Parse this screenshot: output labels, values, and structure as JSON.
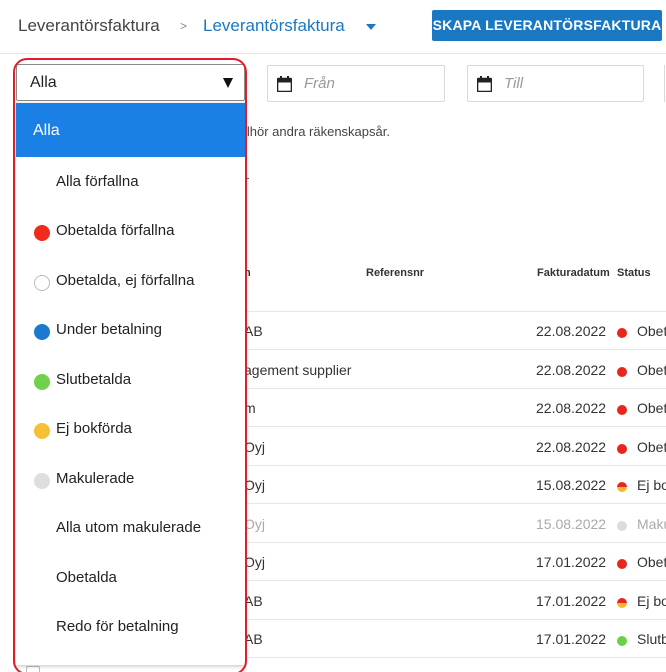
{
  "header": {
    "breadcrumb_root": "Leverantörsfaktura",
    "breadcrumb_sep": ">",
    "breadcrumb_current": "Leverantörsfaktura",
    "create_button": "SKAPA LEVERANTÖRSFAKTURA"
  },
  "filters": {
    "select_value": "Alla",
    "from_placeholder": "Från",
    "to_placeholder": "Till"
  },
  "hint_text": "llhör andra räkenskapsår.",
  "table": {
    "columns": {
      "name": "n",
      "ref": "Referensnr",
      "date": "Fakturadatum",
      "status": "Status"
    },
    "rows": [
      {
        "name": "AB",
        "date": "22.08.2022",
        "status": "Obet",
        "color": "#e8261d"
      },
      {
        "name": "agement supplier",
        "date": "22.08.2022",
        "status": "Obet",
        "color": "#e8261d"
      },
      {
        "name": "m",
        "date": "22.08.2022",
        "status": "Obet",
        "color": "#e8261d"
      },
      {
        "name": "Oyj",
        "date": "22.08.2022",
        "status": "Obet",
        "color": "#e8261d"
      },
      {
        "name": "Oyj",
        "date": "15.08.2022",
        "status": "Ej bok",
        "color": "#e8261d",
        "color2": "#f5b82e"
      },
      {
        "name": "Oyj",
        "date": "15.08.2022",
        "status": "Maku",
        "color": "#dcdcdc",
        "muted": true
      },
      {
        "name": "Oyj",
        "date": "17.01.2022",
        "status": "Obet",
        "color": "#e8261d"
      },
      {
        "name": "AB",
        "date": "17.01.2022",
        "status": "Ej bo",
        "color": "#e8261d",
        "color2": "#f5b82e"
      },
      {
        "name": "AB",
        "date": "17.01.2022",
        "status": "Slutb",
        "color": "#6ccf4a"
      }
    ]
  },
  "dropdown": {
    "options": [
      {
        "label": "Alla",
        "dot": null,
        "selected": true
      },
      {
        "label": "Alla förfallna",
        "dot": null
      },
      {
        "label": "Obetalda förfallna",
        "dot": "#f02a1c"
      },
      {
        "label": "Obetalda, ej förfallna",
        "dot": "outline"
      },
      {
        "label": "Under betalning",
        "dot": "#1a7ad0"
      },
      {
        "label": "Slutbetalda",
        "dot": "#72d14c"
      },
      {
        "label": "Ej bokförda",
        "dot": "#f7bf36"
      },
      {
        "label": "Makulerade",
        "dot": "#dedede"
      },
      {
        "label": "Alla utom makulerade",
        "dot": null
      },
      {
        "label": "Obetalda",
        "dot": null
      },
      {
        "label": "Redo för betalning",
        "dot": null
      }
    ]
  }
}
